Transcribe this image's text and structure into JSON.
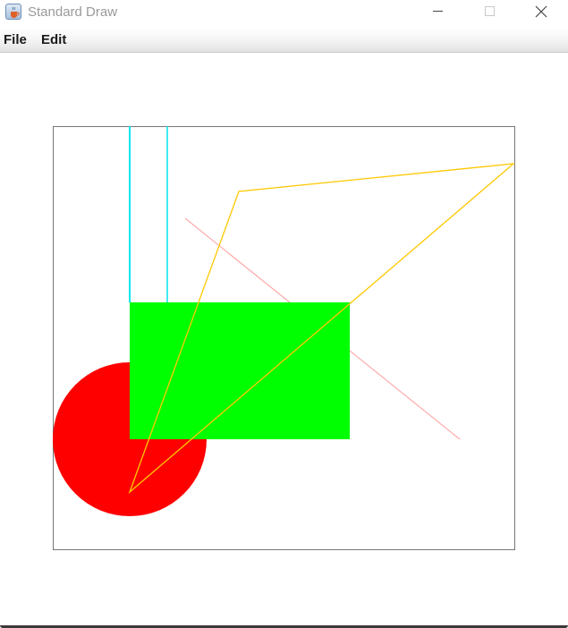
{
  "window": {
    "title": "Standard Draw",
    "app_icon": "java-cup-icon",
    "controls": [
      "minimize-icon",
      "maximize-icon",
      "close-icon"
    ]
  },
  "menubar": {
    "items": [
      {
        "label": "File"
      },
      {
        "label": "Edit"
      }
    ]
  },
  "canvas": {
    "background": "#ffffff",
    "frame_color": "#777777",
    "shapes": [
      {
        "kind": "filled-circle",
        "color": "#ff0000"
      },
      {
        "kind": "filled-rectangle",
        "color": "#00ff00"
      },
      {
        "kind": "line",
        "color": "#00e5ee"
      },
      {
        "kind": "line",
        "color": "#00e5ee"
      },
      {
        "kind": "line",
        "color": "#ffaaaa"
      },
      {
        "kind": "polygon",
        "color": "#ffc800"
      }
    ]
  }
}
